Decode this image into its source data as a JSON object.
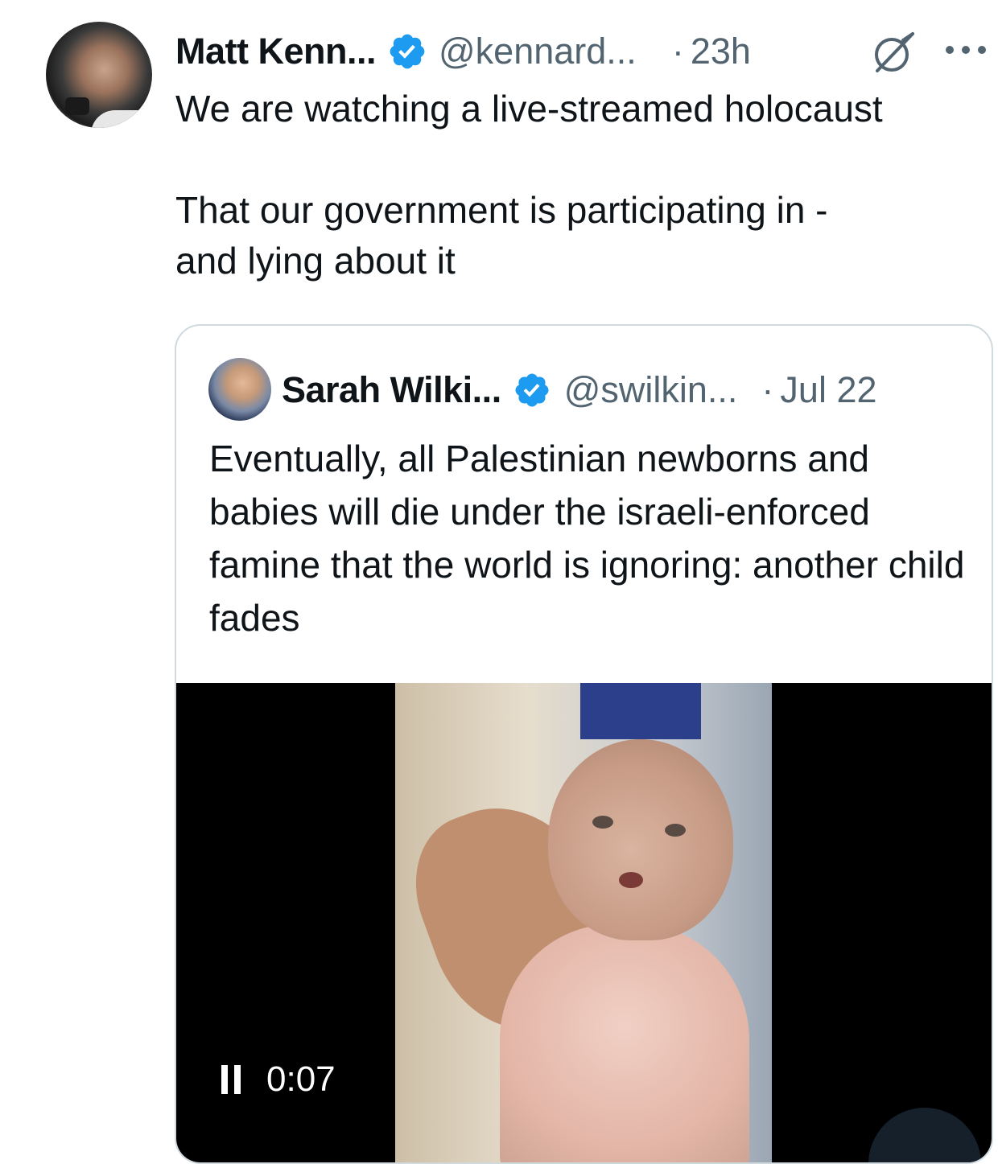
{
  "tweet": {
    "author_name": "Matt Kenn...",
    "author_handle": "@kennard...",
    "separator": "·",
    "timestamp": "23h",
    "text": "We are watching a live-streamed holocaust\n\nThat our government is participating in -\nand lying about it",
    "icons": {
      "verified": "verified-badge-icon",
      "grok": "grok-icon",
      "more": "more-options-icon"
    }
  },
  "quote": {
    "author_name": "Sarah Wilki...",
    "author_handle": "@swilkin...",
    "separator": "·",
    "timestamp": "Jul 22",
    "text": "Eventually, all Palestinian newborns and babies will die under the israeli-enforced famine that the world is ignoring: another child fades",
    "video": {
      "time": "0:07",
      "state": "playing"
    }
  },
  "colors": {
    "verified_blue": "#1d9bf0",
    "secondary_text": "#536471",
    "primary_text": "#0f1419",
    "card_border": "#cfd9de"
  }
}
